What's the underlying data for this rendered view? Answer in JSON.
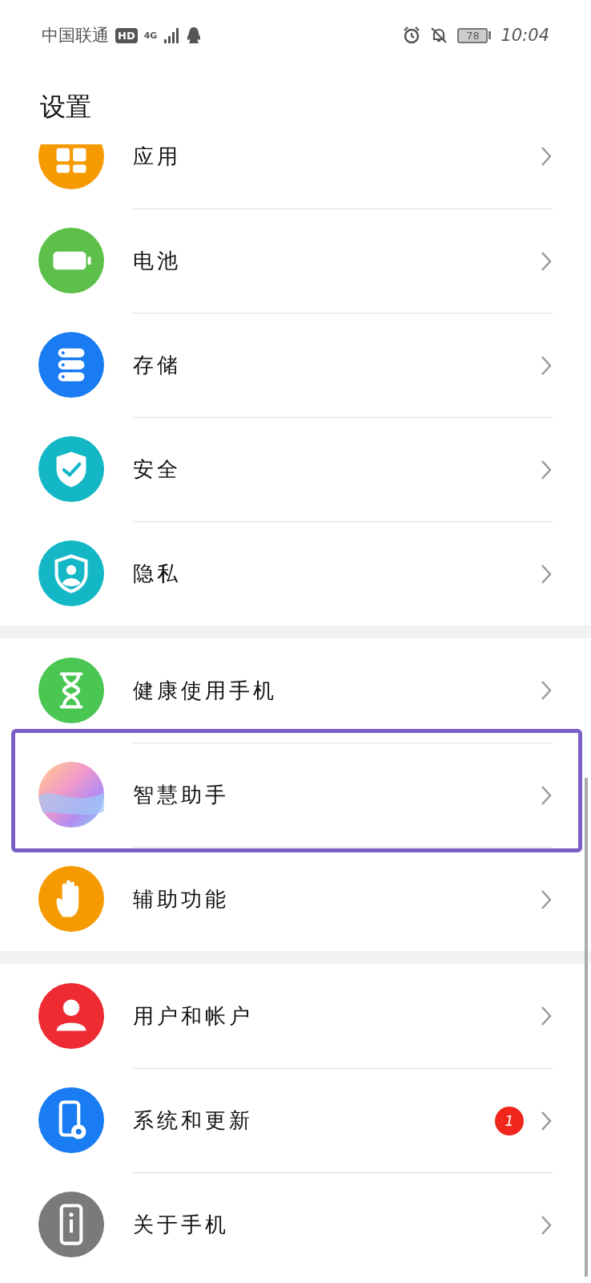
{
  "status_bar": {
    "carrier": "中国联通",
    "hd": "HD",
    "network": "4G",
    "battery": "78",
    "time": "10:04"
  },
  "title": "设置",
  "groups": [
    {
      "items": [
        {
          "kind": "apps",
          "label": "应用",
          "color": "#f59a00",
          "highlighted": false
        },
        {
          "kind": "battery",
          "label": "电池",
          "color": "#5cc04a",
          "highlighted": false
        },
        {
          "kind": "storage",
          "label": "存储",
          "color": "#1a7cf2",
          "highlighted": false
        },
        {
          "kind": "security",
          "label": "安全",
          "color": "#13b7c6",
          "highlighted": false
        },
        {
          "kind": "privacy",
          "label": "隐私",
          "color": "#13b7c6",
          "highlighted": false
        }
      ]
    },
    {
      "items": [
        {
          "kind": "hourglass",
          "label": "健康使用手机",
          "color": "#4ac652",
          "highlighted": false
        },
        {
          "kind": "assistant",
          "label": "智慧助手",
          "highlighted": true
        },
        {
          "kind": "hand",
          "label": "辅助功能",
          "color": "#f59a00",
          "highlighted": false
        }
      ]
    },
    {
      "items": [
        {
          "kind": "user",
          "label": "用户和帐户",
          "color": "#ee2b32",
          "highlighted": false
        },
        {
          "kind": "system",
          "label": "系统和更新",
          "color": "#1a7cf2",
          "highlighted": false,
          "badge": "1"
        },
        {
          "kind": "phone",
          "label": "关于手机",
          "color": "#7a7a7a",
          "highlighted": false
        }
      ]
    }
  ]
}
